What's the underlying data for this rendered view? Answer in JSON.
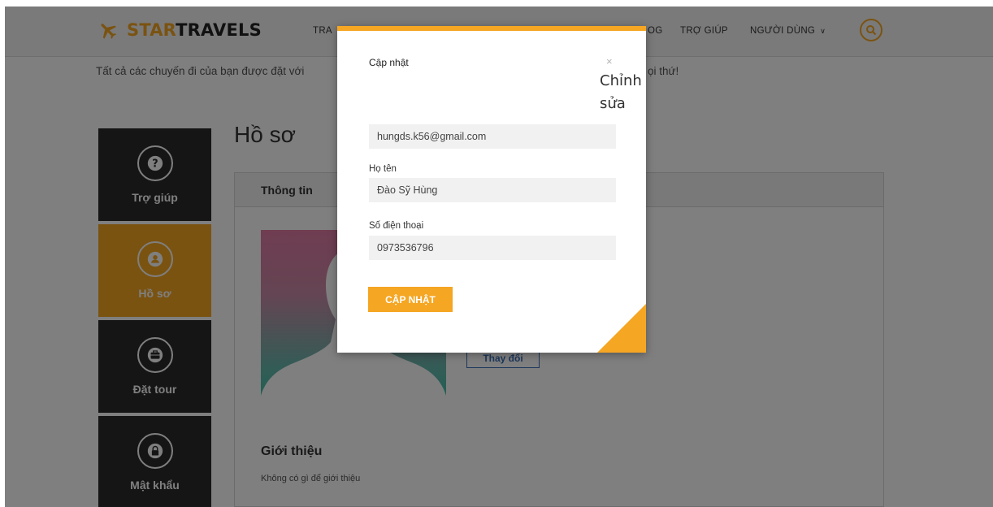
{
  "colors": {
    "accent": "#f5a623",
    "sidebar_dark": "#2b2b2b",
    "overlay": "rgba(0,0,0,0.5)",
    "link_blue": "#3b6fb6"
  },
  "header": {
    "logo": {
      "star": "STAR",
      "travels": "TRAVELS",
      "icon": "plane-icon"
    },
    "nav": {
      "item1_partial": "TRA",
      "item_partial_right": "OG",
      "help": "TRỢ GIÚP",
      "user": "NGƯỜI DÙNG",
      "user_chevron": "∨",
      "search_icon": "search-icon"
    }
  },
  "page": {
    "subtitle": "Tất cả các chuyến đi của bạn được đặt với",
    "subtitle_end": "ọi thứ!",
    "section_title": "Hồ sơ"
  },
  "sidebar": {
    "items": [
      {
        "label": "Trợ giúp",
        "icon": "help-icon",
        "active": false
      },
      {
        "label": "Hồ sơ",
        "icon": "user-icon",
        "active": true
      },
      {
        "label": "Đặt tour",
        "icon": "briefcase-icon",
        "active": false
      },
      {
        "label": "Mật khẩu",
        "icon": "lock-icon",
        "active": false
      }
    ]
  },
  "panel": {
    "tab": "Thông tin",
    "change_button": "Thay đổi",
    "intro_title": "Giới thiệu",
    "intro_text": "Không có gì để giới thiệu"
  },
  "modal": {
    "title": "Cập nhật",
    "close": "×",
    "edit": "Chỉnh sửa",
    "email": "hungds.k56@gmail.com",
    "name_label": "Họ tên",
    "name": "Đào Sỹ Hùng",
    "phone_label": "Số điện thoại",
    "phone": "0973536796",
    "submit": "CẬP NHẬT"
  }
}
